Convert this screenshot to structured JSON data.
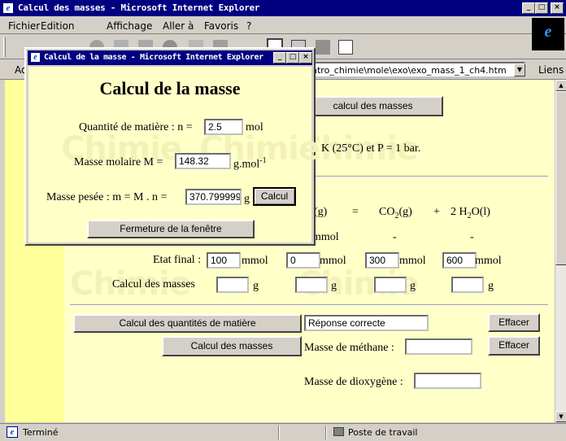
{
  "window": {
    "title": "Calcul des masses - Microsoft Internet Explorer"
  },
  "menu": [
    "Fichier",
    "Edition",
    "Affichage",
    "Aller à",
    "Favoris",
    "?"
  ],
  "address": {
    "label": "Ad",
    "value": "ntro_chimie\\mole\\exo\\exo_mass_1_ch4.htm",
    "links": "Liens"
  },
  "page": {
    "top_button": "calcul des masses",
    "conditions": "K (25°C) et P = 1 bar.",
    "reaction": {
      "co2_sub": "2",
      "co2_state": "(g)",
      "h2o_prefix": "2 H",
      "h2o_sub": "2",
      "h2o_state": "O(l)",
      "frag_state": "(g)",
      "frag_sub": "2",
      "eq": "=",
      "plus": "+",
      "co2": "CO"
    },
    "initial_row": {
      "unit": "mmol",
      "dash1": "-",
      "dash2": "-"
    },
    "final_row": {
      "label": "Etat final :",
      "values": [
        "100",
        "0",
        "300",
        "600"
      ],
      "unit": "mmol"
    },
    "masses_row": {
      "label": "Calcul des masses",
      "unit": "g"
    },
    "btn_quantites": "Calcul des quantités de matière",
    "answer": "Réponse correcte",
    "btn_effacer_1": "Effacer",
    "btn_masses": "Calcul des masses",
    "label_methane": "Masse de méthane :",
    "btn_effacer_2": "Effacer",
    "label_dioxygene": "Masse de dioxygène :"
  },
  "popup": {
    "title": "Calcul de la masse - Microsoft Internet Explorer",
    "heading": "Calcul de la masse",
    "quantity_label": "Quantité de matière : n =",
    "quantity_value": "2.5",
    "quantity_unit": "mol",
    "molar_label": "Masse molaire M =",
    "molar_value": "148.32",
    "molar_unit": "g.mol",
    "molar_exp": "-1",
    "mass_label": "Masse pesée : m = M . n =",
    "mass_value": "370.799999",
    "mass_unit": "g",
    "calc_button": "Calcul",
    "close_button": "Fermeture de la fenêtre"
  },
  "status": {
    "left": "Terminé",
    "right": "Poste de travail"
  },
  "watermark": "Chimie"
}
